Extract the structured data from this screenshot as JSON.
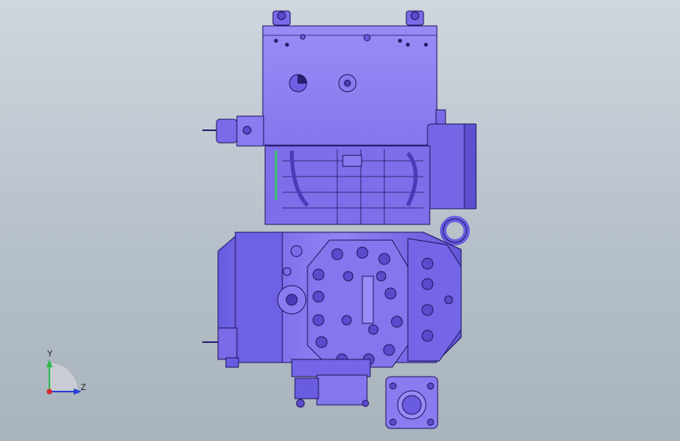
{
  "viewport": {
    "background_top": "#cfd7de",
    "background_bottom": "#a9b3bd"
  },
  "model": {
    "part_color": "#8a7cf0",
    "part_shade": "#5e4fd0",
    "edge_color": "#1e1560",
    "accent_green": "#3fbf6a"
  },
  "triad": {
    "y_label": "Y",
    "z_label": "Z",
    "y_color": "#2fb84a",
    "z_color": "#2a3fd6",
    "x_color": "#d62a2a"
  }
}
